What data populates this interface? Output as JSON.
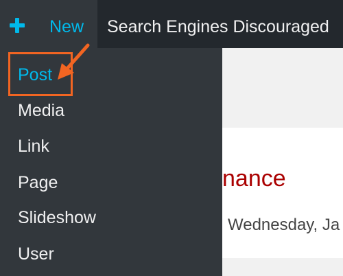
{
  "adminbar": {
    "new_label": "New",
    "site_status": "Search Engines Discouraged"
  },
  "new_menu": {
    "items": [
      {
        "label": "Post",
        "active": true
      },
      {
        "label": "Media"
      },
      {
        "label": "Link"
      },
      {
        "label": "Page"
      },
      {
        "label": "Slideshow"
      },
      {
        "label": "User"
      }
    ]
  },
  "content": {
    "post_title_fragment": "nance",
    "post_date_fragment": "Wednesday, Ja"
  },
  "colors": {
    "adminbar_bg": "#23282d",
    "menu_bg": "#32373c",
    "accent_blue": "#00b9eb",
    "annotation_orange": "#f26522",
    "title_red": "#a00"
  },
  "icons": {
    "new": "plus-icon",
    "annotation": "arrow-icon"
  }
}
